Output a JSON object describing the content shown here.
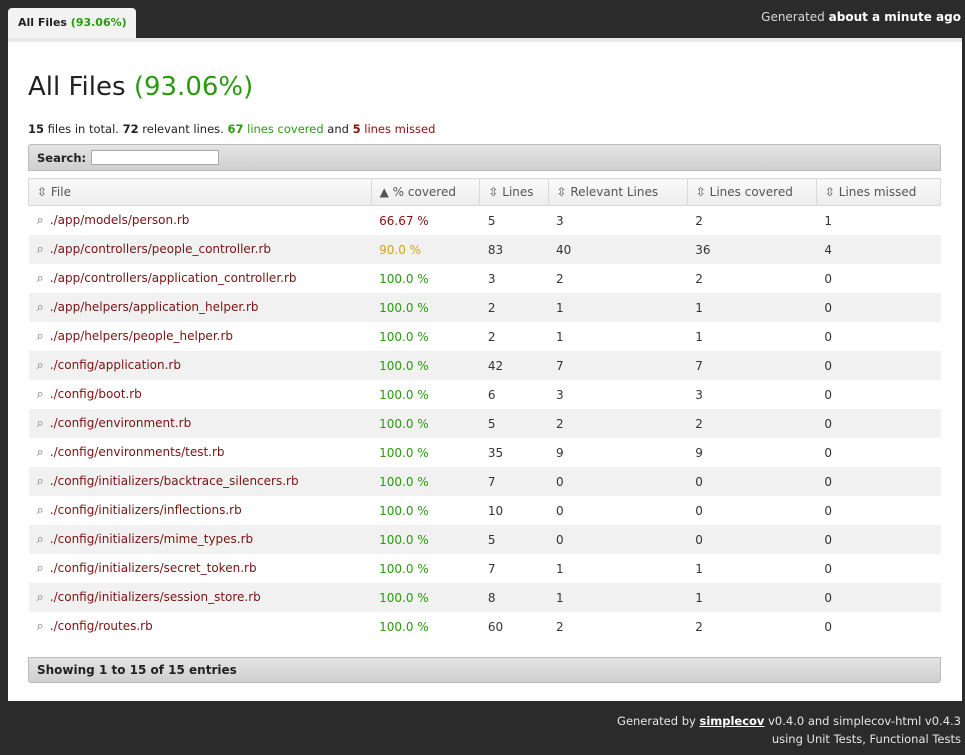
{
  "tab": {
    "label": "All Files",
    "percent": "(93.06%)"
  },
  "generated": {
    "prefix": "Generated",
    "when": "about a minute ago"
  },
  "title": {
    "text": "All Files",
    "percent": "(93.06%)"
  },
  "summary": {
    "files": "15",
    "files_text": "files in total.",
    "relevant": "72",
    "relevant_text": "relevant lines.",
    "covered": "67",
    "covered_text": "lines covered",
    "and": "and",
    "missed": "5",
    "missed_text": "lines missed"
  },
  "search": {
    "label": "Search:",
    "value": ""
  },
  "columns": [
    "⇳ File",
    "▲ % covered",
    "⇳ Lines",
    "⇳ Relevant Lines",
    "⇳ Lines covered",
    "⇳ Lines missed"
  ],
  "rows": [
    {
      "file": "./app/models/person.rb",
      "pct": "66.67 %",
      "status": "red",
      "lines": "5",
      "relevant": "3",
      "covered": "2",
      "missed": "1"
    },
    {
      "file": "./app/controllers/people_controller.rb",
      "pct": "90.0 %",
      "status": "yellow",
      "lines": "83",
      "relevant": "40",
      "covered": "36",
      "missed": "4"
    },
    {
      "file": "./app/controllers/application_controller.rb",
      "pct": "100.0 %",
      "status": "green",
      "lines": "3",
      "relevant": "2",
      "covered": "2",
      "missed": "0"
    },
    {
      "file": "./app/helpers/application_helper.rb",
      "pct": "100.0 %",
      "status": "green",
      "lines": "2",
      "relevant": "1",
      "covered": "1",
      "missed": "0"
    },
    {
      "file": "./app/helpers/people_helper.rb",
      "pct": "100.0 %",
      "status": "green",
      "lines": "2",
      "relevant": "1",
      "covered": "1",
      "missed": "0"
    },
    {
      "file": "./config/application.rb",
      "pct": "100.0 %",
      "status": "green",
      "lines": "42",
      "relevant": "7",
      "covered": "7",
      "missed": "0"
    },
    {
      "file": "./config/boot.rb",
      "pct": "100.0 %",
      "status": "green",
      "lines": "6",
      "relevant": "3",
      "covered": "3",
      "missed": "0"
    },
    {
      "file": "./config/environment.rb",
      "pct": "100.0 %",
      "status": "green",
      "lines": "5",
      "relevant": "2",
      "covered": "2",
      "missed": "0"
    },
    {
      "file": "./config/environments/test.rb",
      "pct": "100.0 %",
      "status": "green",
      "lines": "35",
      "relevant": "9",
      "covered": "9",
      "missed": "0"
    },
    {
      "file": "./config/initializers/backtrace_silencers.rb",
      "pct": "100.0 %",
      "status": "green",
      "lines": "7",
      "relevant": "0",
      "covered": "0",
      "missed": "0"
    },
    {
      "file": "./config/initializers/inflections.rb",
      "pct": "100.0 %",
      "status": "green",
      "lines": "10",
      "relevant": "0",
      "covered": "0",
      "missed": "0"
    },
    {
      "file": "./config/initializers/mime_types.rb",
      "pct": "100.0 %",
      "status": "green",
      "lines": "5",
      "relevant": "0",
      "covered": "0",
      "missed": "0"
    },
    {
      "file": "./config/initializers/secret_token.rb",
      "pct": "100.0 %",
      "status": "green",
      "lines": "7",
      "relevant": "1",
      "covered": "1",
      "missed": "0"
    },
    {
      "file": "./config/initializers/session_store.rb",
      "pct": "100.0 %",
      "status": "green",
      "lines": "8",
      "relevant": "1",
      "covered": "1",
      "missed": "0"
    },
    {
      "file": "./config/routes.rb",
      "pct": "100.0 %",
      "status": "green",
      "lines": "60",
      "relevant": "2",
      "covered": "2",
      "missed": "0"
    }
  ],
  "showing": "Showing 1 to 15 of 15 entries",
  "footer": {
    "line1_prefix": "Generated by",
    "link": "simplecov",
    "line1_suffix": "v0.4.0 and simplecov-html v0.4.3",
    "line2": "using Unit Tests, Functional Tests"
  },
  "colors": {
    "red": "#8b0e0e",
    "yellow": "#d2a50f",
    "green": "#2a9a0f"
  }
}
